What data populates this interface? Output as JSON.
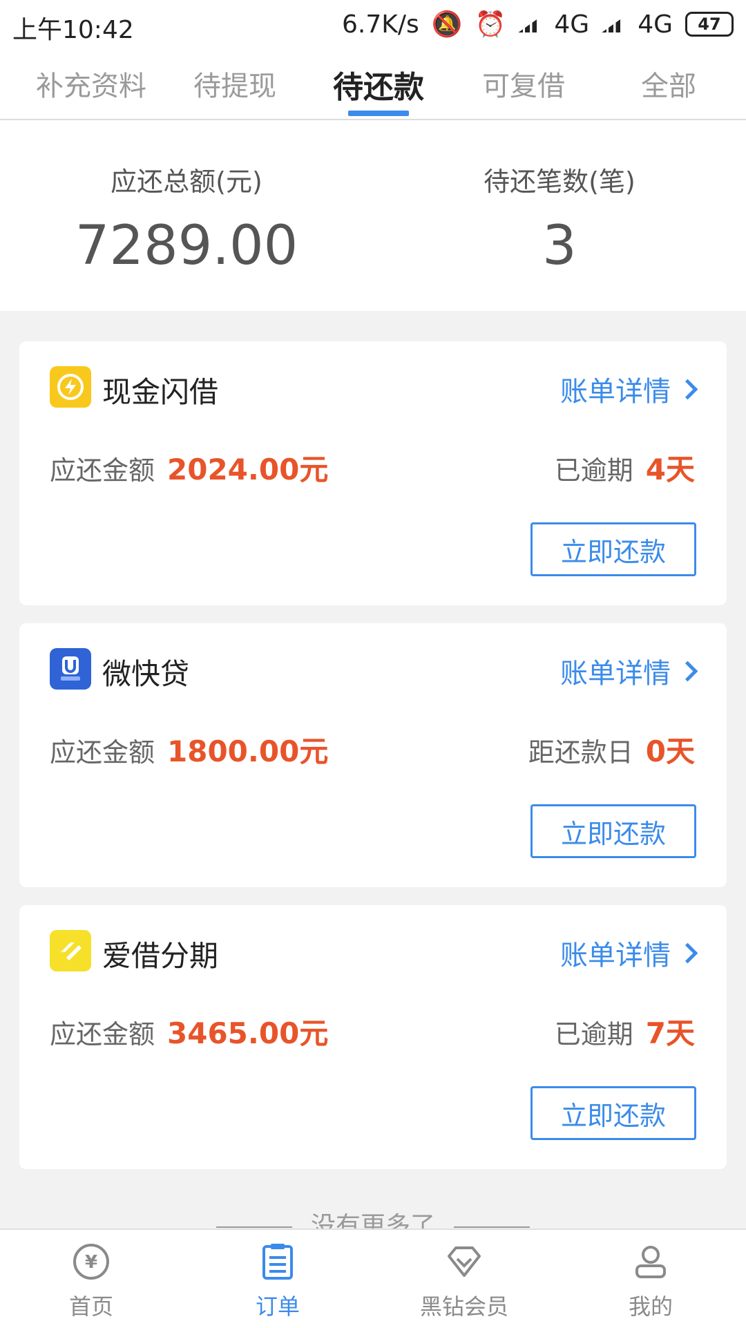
{
  "status_bar": {
    "time": "上午10:42",
    "network_speed": "6.7K/s",
    "net1": "4G",
    "net2": "4G",
    "battery": "47"
  },
  "tabs": [
    {
      "label": "补充资料"
    },
    {
      "label": "待提现"
    },
    {
      "label": "待还款",
      "active": true
    },
    {
      "label": "可复借"
    },
    {
      "label": "全部"
    }
  ],
  "summary": {
    "total_label": "应还总额(元)",
    "total_value": "7289.00",
    "count_label": "待还笔数(笔)",
    "count_value": "3"
  },
  "cards": [
    {
      "name": "现金闪借",
      "logo_icon": "lightning-icon",
      "logo_color": "#f9c81c",
      "detail_label": "账单详情",
      "amount_label": "应还金额",
      "amount_value": "2024.00元",
      "status_label": "已逾期",
      "status_value": "4天",
      "button_label": "立即还款"
    },
    {
      "name": "微快贷",
      "logo_icon": "u-badge-icon",
      "logo_color": "#2f63d6",
      "detail_label": "账单详情",
      "amount_label": "应还金额",
      "amount_value": "1800.00元",
      "status_label": "距还款日",
      "status_value": "0天",
      "button_label": "立即还款"
    },
    {
      "name": "爱借分期",
      "logo_icon": "stripes-icon",
      "logo_color": "#f6e02a",
      "detail_label": "账单详情",
      "amount_label": "应还金额",
      "amount_value": "3465.00元",
      "status_label": "已逾期",
      "status_value": "7天",
      "button_label": "立即还款"
    }
  ],
  "footer_hint": "没有更多了",
  "bottom_nav": [
    {
      "label": "首页",
      "icon": "yen-coin-icon"
    },
    {
      "label": "订单",
      "icon": "clipboard-icon",
      "active": true
    },
    {
      "label": "黑钻会员",
      "icon": "diamond-icon"
    },
    {
      "label": "我的",
      "icon": "user-icon"
    }
  ],
  "colors": {
    "accent": "#3b8bea",
    "warning": "#e8542a"
  }
}
